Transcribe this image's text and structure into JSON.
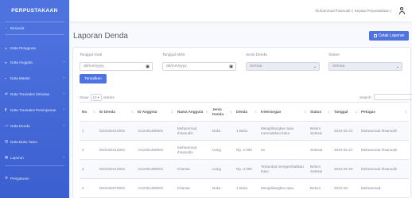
{
  "sidebar": {
    "brand": "PERPUSTAKAAN",
    "items": [
      {
        "label": "Beranda",
        "icon": "dashboard-icon",
        "chevron": false
      },
      {
        "label": "Data Pengguna",
        "icon": "user-icon",
        "chevron": false
      },
      {
        "label": "Data Anggota",
        "icon": "users-icon",
        "chevron": true
      },
      {
        "label": "Data Master",
        "icon": "folder-icon",
        "chevron": true
      },
      {
        "label": "Data Transaksi Sirkulasi",
        "icon": "exchange-icon",
        "chevron": true
      },
      {
        "label": "Data Transaksi Peminjaman",
        "icon": "book-icon",
        "chevron": true
      },
      {
        "label": "Data Denda",
        "icon": "money-icon",
        "chevron": true
      },
      {
        "label": "Data Buku Tamu",
        "icon": "guestbook-icon",
        "chevron": false
      },
      {
        "label": "Laporan",
        "icon": "report-icon",
        "chevron": true
      },
      {
        "label": "Pengaturan",
        "icon": "gear-icon",
        "chevron": false
      }
    ]
  },
  "topbar": {
    "user_name": "Muhammad Ihsanudin | Kepala Perpustakaan |",
    "user_icon": "user-profile-icon"
  },
  "page": {
    "title": "Laporan Denda",
    "print_label": "Cetak Laporan"
  },
  "filters": {
    "start_label": "Tanggal Awal",
    "start_placeholder": "dd/mm/yyyy",
    "end_label": "Tanggal Akhir",
    "end_placeholder": "dd/mm/yyyy",
    "type_label": "Jenis Denda",
    "type_value": "Semua",
    "status_label": "Status",
    "status_value": "Semua",
    "show_label": "Tampilkan"
  },
  "table": {
    "length_prefix": "Show",
    "length_value": "10",
    "length_suffix": "entries",
    "search_label": "Search:",
    "columns": [
      "No",
      "ID Denda",
      "ID Anggota",
      "Nama Anggota",
      "Jenis Denda",
      "Denda",
      "Keterangan",
      "Status",
      "Tanggal",
      "Petugas"
    ],
    "rows": [
      [
        "1",
        "DD2402210001",
        "AG2301490001",
        "Muhammad Ihsanudin",
        "Buku",
        "1 Buku",
        "Menghilangkan atau merusakkan buku",
        "Belum Selesai",
        "2024-02-21",
        "Muhammad Ihsanudin"
      ],
      [
        "2",
        "DD2402210001",
        "AG2301490001",
        "Muhammad Ihsanudin",
        "Uang",
        "Rp. 2.000",
        "ee",
        "Selesai",
        "2024-02-21",
        "Muhammad Ihsanudin"
      ],
      [
        "3",
        "DD2402210001",
        "AG2301490001",
        "Khansa",
        "Uang",
        "Rp. 3.000",
        "Terlambat mengembalikan buku",
        "Belum Selesai",
        "2024-02-20",
        "Muhammad Ihsanudin"
      ],
      [
        "4",
        "DD2402070001",
        "AG2301490001",
        "Khansa",
        "Buku",
        "1 Buku",
        "Menghilangkan atau",
        "Belum",
        "2024-02-",
        "Muhammad"
      ]
    ]
  },
  "colors": {
    "primary": "#4e73df",
    "text": "#5a5c69",
    "muted": "#858796"
  }
}
